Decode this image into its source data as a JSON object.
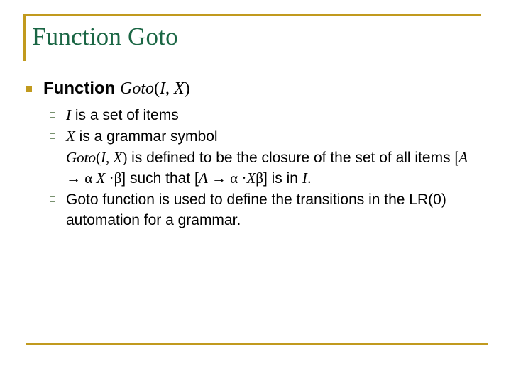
{
  "slide": {
    "title": "Function Goto",
    "accent_gold": "#C19A1E",
    "title_green": "#1A6644",
    "sub_bullet_green": "#78916F",
    "body_black": "#000000",
    "heading": {
      "label_plain": "Function ",
      "label_math_name": "Goto",
      "label_math_open": "(",
      "label_math_i": "I",
      "label_math_comma": ", ",
      "label_math_x": "X",
      "label_math_close": ")"
    },
    "bullets": [
      {
        "id": "bullet-items-set",
        "parts": [
          {
            "type": "math-italic",
            "text": "I"
          },
          {
            "type": "plain",
            "text": " is a set of items"
          }
        ]
      },
      {
        "id": "bullet-grammar-symbol",
        "parts": [
          {
            "type": "math-italic",
            "text": "X"
          },
          {
            "type": "plain",
            "text": " is a grammar symbol"
          }
        ]
      },
      {
        "id": "bullet-goto-definition",
        "parts": [
          {
            "type": "math-italic",
            "text": "Goto"
          },
          {
            "type": "math-roman",
            "text": "("
          },
          {
            "type": "math-italic",
            "text": "I"
          },
          {
            "type": "math-roman",
            "text": ", "
          },
          {
            "type": "math-italic",
            "text": "X"
          },
          {
            "type": "math-roman",
            "text": ")"
          },
          {
            "type": "plain",
            "text": " is defined to be the closure of the set of all items ["
          },
          {
            "type": "math-italic",
            "text": "A"
          },
          {
            "type": "symbol",
            "text": " → "
          },
          {
            "type": "symbol",
            "text": "α"
          },
          {
            "type": "math-italic",
            "text": " X"
          },
          {
            "type": "symbol",
            "text": " ·"
          },
          {
            "type": "symbol",
            "text": "β"
          },
          {
            "type": "plain",
            "text": "] such that ["
          },
          {
            "type": "math-italic",
            "text": "A"
          },
          {
            "type": "symbol",
            "text": " → "
          },
          {
            "type": "symbol",
            "text": "α"
          },
          {
            "type": "symbol",
            "text": " ·"
          },
          {
            "type": "math-italic",
            "text": "X"
          },
          {
            "type": "symbol",
            "text": "β"
          },
          {
            "type": "plain",
            "text": "] is in "
          },
          {
            "type": "math-italic",
            "text": "I"
          },
          {
            "type": "plain",
            "text": "."
          }
        ]
      },
      {
        "id": "bullet-goto-transitions",
        "parts": [
          {
            "type": "plain",
            "text": "Goto function is used to define the transitions in the LR(0) automation for a grammar."
          }
        ]
      }
    ]
  }
}
